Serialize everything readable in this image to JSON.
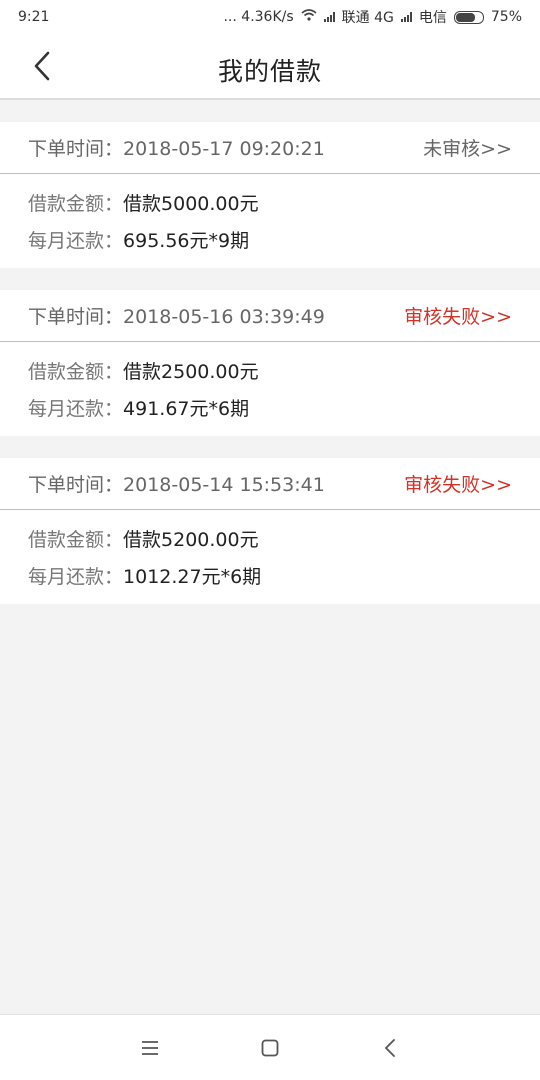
{
  "status_bar": {
    "time": "9:21",
    "speed": "... 4.36K/s",
    "carrier1": "联通 4G",
    "carrier2": "电信",
    "battery": "75%",
    "battery_level": 0.75
  },
  "header": {
    "title": "我的借款"
  },
  "labels": {
    "order_time": "下单时间：",
    "loan_amount": "借款金额：",
    "monthly_repayment": "每月还款："
  },
  "loans": [
    {
      "order_time": "2018-05-17 09:20:21",
      "status": "未审核>>",
      "status_color": "#666666",
      "amount": "借款5000.00元",
      "monthly": "695.56元*9期"
    },
    {
      "order_time": "2018-05-16 03:39:49",
      "status": "审核失败>>",
      "status_color": "#d33226",
      "amount": "借款2500.00元",
      "monthly": "491.67元*6期"
    },
    {
      "order_time": "2018-05-14 15:53:41",
      "status": "审核失败>>",
      "status_color": "#d33226",
      "amount": "借款5200.00元",
      "monthly": "1012.27元*6期"
    }
  ],
  "bottom_nav": [
    "menu-icon",
    "home-square-icon",
    "back-chevron-icon"
  ]
}
